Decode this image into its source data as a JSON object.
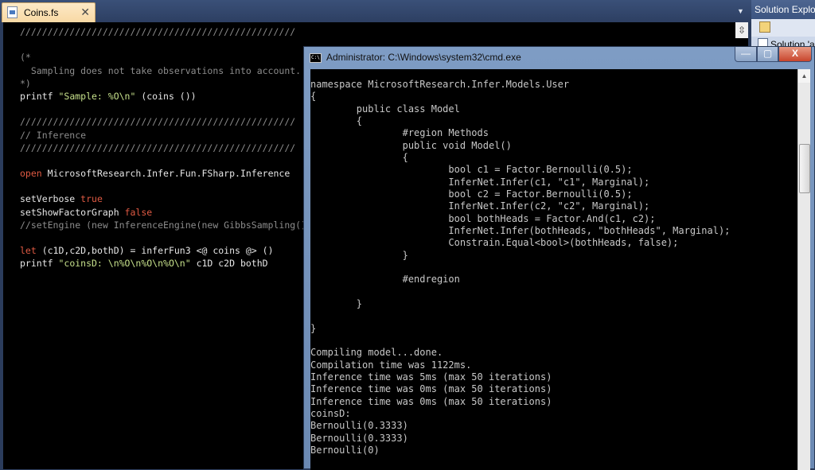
{
  "editor_tab": {
    "label": "Coins.fs",
    "close": "✕"
  },
  "tab_dropdown": "▼",
  "solution_explorer": {
    "title": "Solution Explor",
    "item": "Solution 'a"
  },
  "editor_code": [
    [
      {
        "t": "//////////////////////////////////////////////////",
        "c": "comment"
      }
    ],
    [],
    [
      {
        "t": "(*",
        "c": "comment"
      }
    ],
    [
      {
        "t": "  Sampling does not take observations into account.",
        "c": "comment"
      }
    ],
    [
      {
        "t": "*)",
        "c": "comment"
      }
    ],
    [
      {
        "t": "printf ",
        "c": "plain"
      },
      {
        "t": "\"Sample: %O\\n\"",
        "c": "string"
      },
      {
        "t": " (coins ())",
        "c": "plain"
      }
    ],
    [],
    [
      {
        "t": "//////////////////////////////////////////////////",
        "c": "comment"
      }
    ],
    [
      {
        "t": "// Inference",
        "c": "comment"
      }
    ],
    [
      {
        "t": "//////////////////////////////////////////////////",
        "c": "comment"
      }
    ],
    [],
    [
      {
        "t": "open",
        "c": "keyword"
      },
      {
        "t": " MicrosoftResearch.Infer.Fun.FSharp.Inference",
        "c": "plain"
      }
    ],
    [],
    [
      {
        "t": "setVerbose ",
        "c": "plain"
      },
      {
        "t": "true",
        "c": "keyword"
      }
    ],
    [
      {
        "t": "setShowFactorGraph ",
        "c": "plain"
      },
      {
        "t": "false",
        "c": "keyword"
      }
    ],
    [
      {
        "t": "//setEngine (new InferenceEngine(new GibbsSampling()",
        "c": "comment"
      }
    ],
    [],
    [
      {
        "t": "let",
        "c": "keyword"
      },
      {
        "t": " (c1D,c2D,bothD) = inferFun3 <@ coins @> ()",
        "c": "plain"
      }
    ],
    [
      {
        "t": "printf ",
        "c": "plain"
      },
      {
        "t": "\"coinsD: \\n%O\\n%O\\n%O\\n\"",
        "c": "string"
      },
      {
        "t": " c1D c2D bothD",
        "c": "plain"
      }
    ]
  ],
  "cmd": {
    "title": "Administrator: C:\\Windows\\system32\\cmd.exe",
    "icon_text": "C:\\",
    "buttons": {
      "minimize": "—",
      "maximize": "▢",
      "close": "X"
    },
    "lines": [
      "namespace MicrosoftResearch.Infer.Models.User",
      "{",
      "        public class Model",
      "        {",
      "                #region Methods",
      "                public void Model()",
      "                {",
      "                        bool c1 = Factor.Bernoulli(0.5);",
      "                        InferNet.Infer(c1, \"c1\", Marginal);",
      "                        bool c2 = Factor.Bernoulli(0.5);",
      "                        InferNet.Infer(c2, \"c2\", Marginal);",
      "                        bool bothHeads = Factor.And(c1, c2);",
      "                        InferNet.Infer(bothHeads, \"bothHeads\", Marginal);",
      "                        Constrain.Equal<bool>(bothHeads, false);",
      "                }",
      "",
      "                #endregion",
      "",
      "        }",
      "",
      "}",
      "",
      "Compiling model...done.",
      "Compilation time was 1122ms.",
      "Inference time was 5ms (max 50 iterations)",
      "Inference time was 0ms (max 50 iterations)",
      "Inference time was 0ms (max 50 iterations)",
      "coinsD:",
      "Bernoulli(0.3333)",
      "Bernoulli(0.3333)",
      "Bernoulli(0)"
    ]
  },
  "colors": {
    "comment": "#8c8c8c",
    "string": "#c6e08b",
    "keyword": "#e05a43",
    "plain": "#e6e6e6"
  },
  "icons": {
    "file_icon": "fsharp-file-icon",
    "cmd_icon": "cmd-icon",
    "toolbar_icon": "properties-icon"
  }
}
